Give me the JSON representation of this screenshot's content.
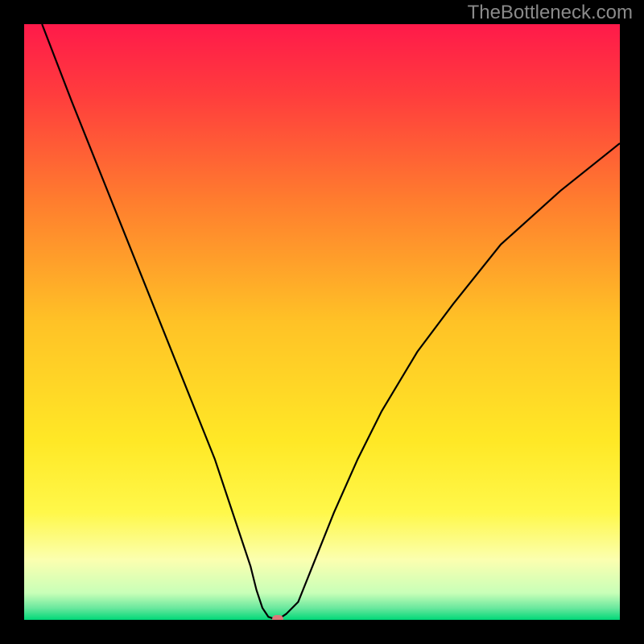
{
  "watermark": "TheBottleneck.com",
  "chart_data": {
    "type": "line",
    "title": "",
    "xlabel": "",
    "ylabel": "",
    "xlim": [
      0,
      100
    ],
    "ylim": [
      0,
      100
    ],
    "grid": false,
    "legend": false,
    "background": {
      "type": "vertical-gradient",
      "stops": [
        {
          "pos": 0.0,
          "color": "#ff1a4a"
        },
        {
          "pos": 0.12,
          "color": "#ff3d3d"
        },
        {
          "pos": 0.3,
          "color": "#ff7e2e"
        },
        {
          "pos": 0.5,
          "color": "#ffc226"
        },
        {
          "pos": 0.7,
          "color": "#ffe826"
        },
        {
          "pos": 0.82,
          "color": "#fff84a"
        },
        {
          "pos": 0.9,
          "color": "#fbffb0"
        },
        {
          "pos": 0.955,
          "color": "#c8ffb8"
        },
        {
          "pos": 0.98,
          "color": "#6be89e"
        },
        {
          "pos": 1.0,
          "color": "#00d878"
        }
      ]
    },
    "series": [
      {
        "name": "bottleneck-curve",
        "color": "#000000",
        "x": [
          3,
          8,
          12,
          16,
          20,
          24,
          28,
          32,
          34,
          36,
          38,
          39,
          40,
          41,
          42.5,
          44,
          46,
          48,
          52,
          56,
          60,
          66,
          72,
          80,
          90,
          100
        ],
        "y": [
          100,
          87,
          77,
          67,
          57,
          47,
          37,
          27,
          21,
          15,
          9,
          5,
          2,
          0.5,
          0,
          1,
          3,
          8,
          18,
          27,
          35,
          45,
          53,
          63,
          72,
          80
        ]
      }
    ],
    "marker": {
      "x": 42.5,
      "y": 0.2,
      "color": "#d97a7a"
    }
  }
}
